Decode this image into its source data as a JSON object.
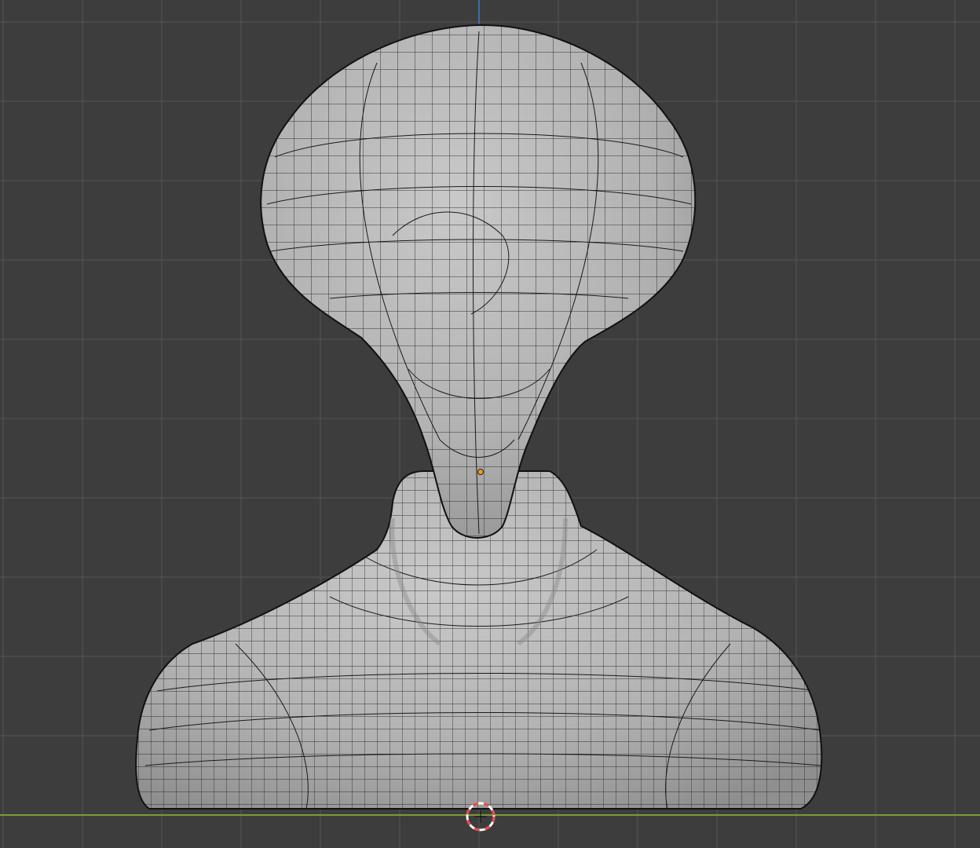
{
  "viewport": {
    "view": "front-orthographic",
    "shading": "solid",
    "overlay": "wireframe"
  },
  "colors": {
    "background": "#3d3d3d",
    "grid_minor": "#4a4a4a",
    "grid_major": "#555555",
    "axis_x": "#7c9b35",
    "axis_z": "#3f6ea8",
    "mesh_fill": "#b4b4b4",
    "mesh_wire": "#111111",
    "origin": "#f39c12",
    "cursor_red": "#e64a4a",
    "cursor_white": "#ffffff"
  },
  "icons": {
    "object_origin": "origin-dot-icon",
    "3d_cursor": "3d-cursor-icon"
  }
}
